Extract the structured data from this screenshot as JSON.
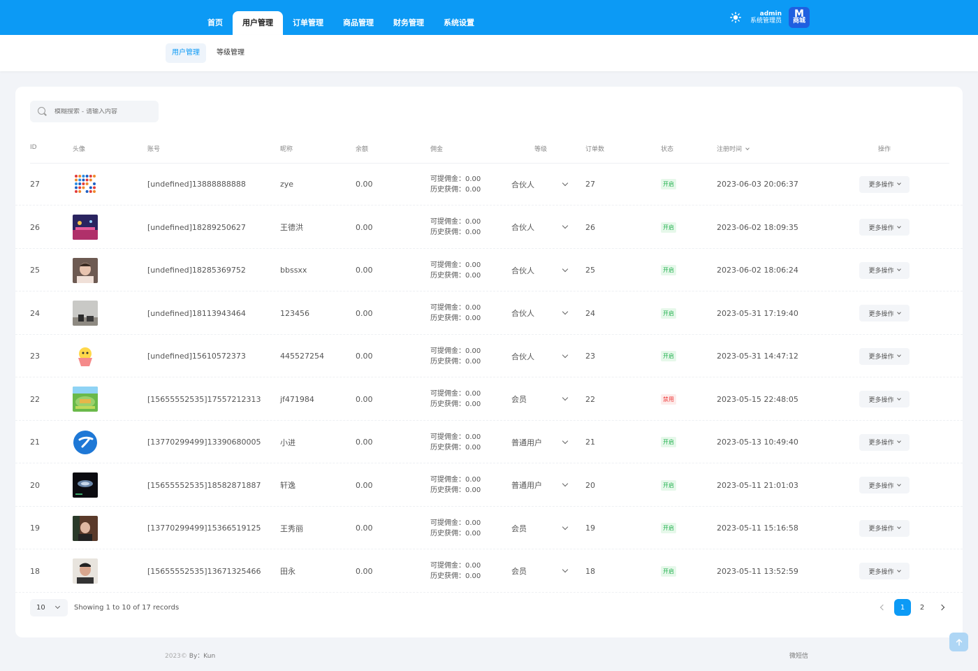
{
  "nav": {
    "items": [
      {
        "label": "首页",
        "active": false
      },
      {
        "label": "用户管理",
        "active": true
      },
      {
        "label": "订单管理",
        "active": false
      },
      {
        "label": "商品管理",
        "active": false
      },
      {
        "label": "财务管理",
        "active": false
      },
      {
        "label": "系统设置",
        "active": false
      }
    ],
    "user": {
      "name": "admin",
      "role": "系统管理员"
    },
    "logo": {
      "glyph": "M",
      "text": "商城"
    }
  },
  "subtabs": [
    {
      "label": "用户管理",
      "active": true
    },
    {
      "label": "等级管理",
      "active": false
    }
  ],
  "search": {
    "placeholder": "模糊搜索 - 请输入内容"
  },
  "table": {
    "headers": {
      "id": "ID",
      "avatar": "头像",
      "account": "账号",
      "nickname": "昵称",
      "balance": "余额",
      "commission": "佣金",
      "level": "等级",
      "orders": "订单数",
      "status": "状态",
      "regtime": "注册时间",
      "actions": "操作"
    },
    "commission_labels": {
      "withdrawable": "可提佣金：",
      "history": "历史获佣："
    },
    "more_label": "更多操作",
    "rows": [
      {
        "id": "27",
        "account": "[undefined]13888888888",
        "nickname": "zye",
        "balance": "0.00",
        "withdrawable": "0.00",
        "history": "0.00",
        "level": "合伙人",
        "orders": "27",
        "status": "开启",
        "status_on": true,
        "regtime": "2023-06-03 20:06:37",
        "avatar_kind": "dots"
      },
      {
        "id": "26",
        "account": "[undefined]18289250627",
        "nickname": "王德洪",
        "balance": "0.00",
        "withdrawable": "0.00",
        "history": "0.00",
        "level": "合伙人",
        "orders": "26",
        "status": "开启",
        "status_on": true,
        "regtime": "2023-06-02 18:09:35",
        "avatar_kind": "night"
      },
      {
        "id": "25",
        "account": "[undefined]18285369752",
        "nickname": "bbssxx",
        "balance": "0.00",
        "withdrawable": "0.00",
        "history": "0.00",
        "level": "合伙人",
        "orders": "25",
        "status": "开启",
        "status_on": true,
        "regtime": "2023-06-02 18:06:24",
        "avatar_kind": "person"
      },
      {
        "id": "24",
        "account": "[undefined]18113943464",
        "nickname": "123456",
        "balance": "0.00",
        "withdrawable": "0.00",
        "history": "0.00",
        "level": "合伙人",
        "orders": "24",
        "status": "开启",
        "status_on": true,
        "regtime": "2023-05-31 17:19:40",
        "avatar_kind": "room"
      },
      {
        "id": "23",
        "account": "[undefined]15610572373",
        "nickname": "445527254",
        "balance": "0.00",
        "withdrawable": "0.00",
        "history": "0.00",
        "level": "合伙人",
        "orders": "23",
        "status": "开启",
        "status_on": true,
        "regtime": "2023-05-31 14:47:12",
        "avatar_kind": "cartoon"
      },
      {
        "id": "22",
        "account": "[15655552535]17557212313",
        "nickname": "jf471984",
        "balance": "0.00",
        "withdrawable": "0.00",
        "history": "0.00",
        "level": "会员",
        "orders": "22",
        "status": "禁用",
        "status_on": false,
        "regtime": "2023-05-15 22:48:05",
        "avatar_kind": "game"
      },
      {
        "id": "21",
        "account": "[13770299499]13390680005",
        "nickname": "小进",
        "balance": "0.00",
        "withdrawable": "0.00",
        "history": "0.00",
        "level": "普通用户",
        "orders": "21",
        "status": "开启",
        "status_on": true,
        "regtime": "2023-05-13 10:49:40",
        "avatar_kind": "telecom"
      },
      {
        "id": "20",
        "account": "[15655552535]18582871887",
        "nickname": "轩逸",
        "balance": "0.00",
        "withdrawable": "0.00",
        "history": "0.00",
        "level": "普通用户",
        "orders": "20",
        "status": "开启",
        "status_on": true,
        "regtime": "2023-05-11 21:01:03",
        "avatar_kind": "dark"
      },
      {
        "id": "19",
        "account": "[13770299499]15366519125",
        "nickname": "王秀丽",
        "balance": "0.00",
        "withdrawable": "0.00",
        "history": "0.00",
        "level": "会员",
        "orders": "19",
        "status": "开启",
        "status_on": true,
        "regtime": "2023-05-11 15:16:58",
        "avatar_kind": "person2"
      },
      {
        "id": "18",
        "account": "[15655552535]13671325466",
        "nickname": "田永",
        "balance": "0.00",
        "withdrawable": "0.00",
        "history": "0.00",
        "level": "会员",
        "orders": "18",
        "status": "开启",
        "status_on": true,
        "regtime": "2023-05-11 13:52:59",
        "avatar_kind": "person3"
      }
    ]
  },
  "pagination": {
    "page_size": "10",
    "records_text": "Showing 1 to 10 of 17 records",
    "pages": [
      "1",
      "2"
    ],
    "current": "1"
  },
  "footer": {
    "left_year": "2023©",
    "left_by": "By：Kun",
    "right": "微短信"
  },
  "colors": {
    "primary": "#0c9af5",
    "status_on": "#1fb04c",
    "status_off": "#ef3b3b"
  }
}
